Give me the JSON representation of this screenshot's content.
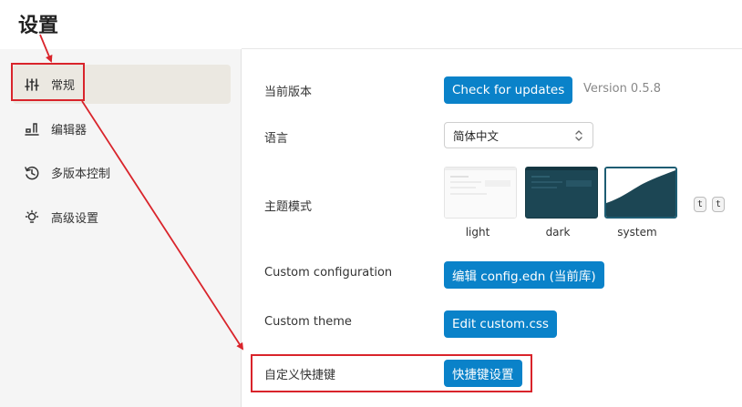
{
  "page": {
    "title": "设置"
  },
  "sidebar": {
    "items": [
      {
        "label": "常规",
        "icon": "sliders-icon",
        "active": true
      },
      {
        "label": "编辑器",
        "icon": "editor-icon",
        "active": false
      },
      {
        "label": "多版本控制",
        "icon": "history-icon",
        "active": false
      },
      {
        "label": "高级设置",
        "icon": "bulb-icon",
        "active": false
      }
    ]
  },
  "general": {
    "version": {
      "label": "当前版本",
      "button": "Check for updates",
      "value": "Version 0.5.8"
    },
    "language": {
      "label": "语言",
      "selected": "简体中文"
    },
    "theme": {
      "label": "主题模式",
      "options": [
        {
          "name": "light",
          "selected": false
        },
        {
          "name": "dark",
          "selected": false
        },
        {
          "name": "system",
          "selected": true
        }
      ],
      "shortcut_keys": [
        "t",
        "t"
      ]
    },
    "custom_config": {
      "label": "Custom configuration",
      "button": "编辑 config.edn (当前库)"
    },
    "custom_theme": {
      "label": "Custom theme",
      "button": "Edit custom.css"
    },
    "shortcuts": {
      "label": "自定义快捷键",
      "button": "快捷键设置"
    }
  },
  "colors": {
    "accent": "#0a82c9",
    "annotation": "#d9242b",
    "active_nav": "#ebe8e1"
  }
}
